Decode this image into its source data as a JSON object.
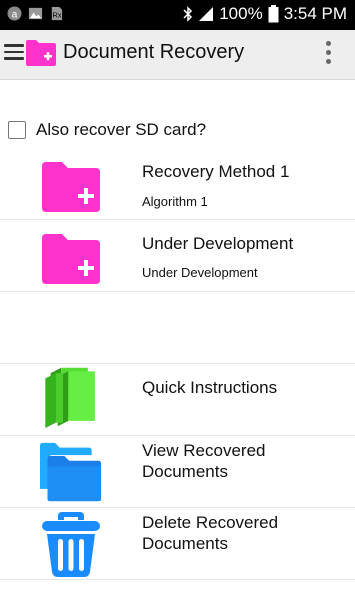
{
  "status_bar": {
    "left_icons": [
      "amazon-icon",
      "image-icon",
      "sim-icon"
    ],
    "battery": "100%",
    "time": "3:54 PM",
    "right_icons": [
      "bluetooth-icon",
      "signal-icon",
      "battery-icon"
    ]
  },
  "app_bar": {
    "title": "Document Recovery",
    "menu_icon": "hamburger-icon",
    "logo_icon": "folder-plus-icon",
    "overflow_icon": "more-vert-icon"
  },
  "sd_option": {
    "label": "Also recover SD card?",
    "checked": false
  },
  "items": [
    {
      "title": "Recovery Method 1",
      "subtitle": "Algorithm 1",
      "icon": "folder-plus-icon",
      "color": "#ff33cc"
    },
    {
      "title": "Under Development",
      "subtitle": "Under Development",
      "icon": "folder-plus-icon",
      "color": "#ff33cc"
    },
    {
      "title": "Quick Instructions",
      "subtitle": "",
      "icon": "books-icon",
      "color": "#44cc22"
    },
    {
      "title": "View Recovered Documents",
      "subtitle": "",
      "icon": "folders-icon",
      "color": "#1a8cff"
    },
    {
      "title": "Delete Recovered Documents",
      "subtitle": "",
      "icon": "trash-icon",
      "color": "#1a8cff"
    }
  ]
}
